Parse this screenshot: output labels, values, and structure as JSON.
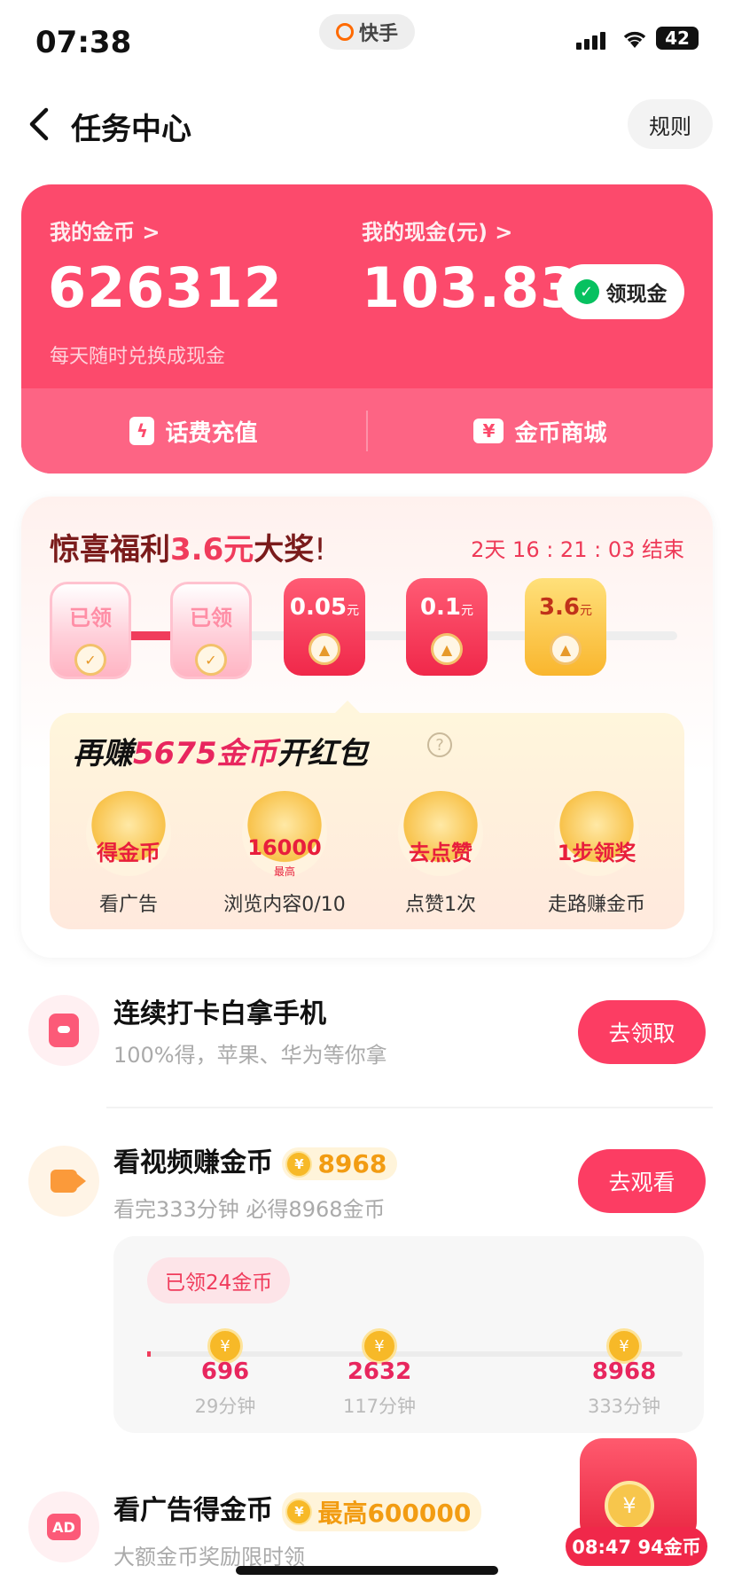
{
  "status": {
    "time": "07:38",
    "app": "快手",
    "battery": "42"
  },
  "header": {
    "title": "任务中心",
    "rules": "规则"
  },
  "wallet": {
    "coins_label": "我的金币 >",
    "coins_value": "626312",
    "coins_hint": "每天随时兑换成现金",
    "cash_label": "我的现金(元) >",
    "cash_value": "103.83",
    "cash_button": "领现金",
    "recharge": "话费充值",
    "mall": "金币商城"
  },
  "reward": {
    "title_a": "惊喜福利",
    "title_b": "3.6元",
    "title_c": "大奖",
    "title_d": "!",
    "countdown": "2天 16 : 21 : 03  结束",
    "envelopes": [
      {
        "label": "已领",
        "state": "done"
      },
      {
        "label": "已领",
        "state": "done"
      },
      {
        "label": "0.05",
        "unit": "元",
        "state": "red"
      },
      {
        "label": "0.1",
        "unit": "元",
        "state": "red"
      },
      {
        "label": "3.6",
        "unit": "元",
        "state": "gold"
      }
    ],
    "earn_a": "再赚",
    "earn_b": "5675金币",
    "earn_c": "开红包",
    "tasks": [
      {
        "cap": "得金币",
        "tiny": "",
        "label": "看广告"
      },
      {
        "cap": "16000",
        "tiny": "最高",
        "label": "浏览内容0/10"
      },
      {
        "cap": "去点赞",
        "tiny": "",
        "label": "点赞1次"
      },
      {
        "cap": "1步领奖",
        "tiny": "",
        "label": "走路赚金币"
      }
    ]
  },
  "list": [
    {
      "name": "连续打卡白拿手机",
      "desc": "100%得，苹果、华为等你拿",
      "button": "去领取",
      "coins": ""
    },
    {
      "name": "看视频赚金币",
      "desc": "看完333分钟 必得8968金币",
      "button": "去观看",
      "coins": "8968"
    },
    {
      "name": "看广告得金币",
      "desc": "大额金币奖励限时领",
      "button": "",
      "coins": "最高600000"
    }
  ],
  "video_progress": {
    "badge": "已领24金币",
    "milestones": [
      {
        "value": "696",
        "time": "29分钟"
      },
      {
        "value": "2632",
        "time": "117分钟"
      },
      {
        "value": "8968",
        "time": "333分钟"
      }
    ]
  },
  "float_widget": {
    "text": "08:47 94金币"
  },
  "icons": {
    "coin": "¥",
    "ad": "AD"
  }
}
